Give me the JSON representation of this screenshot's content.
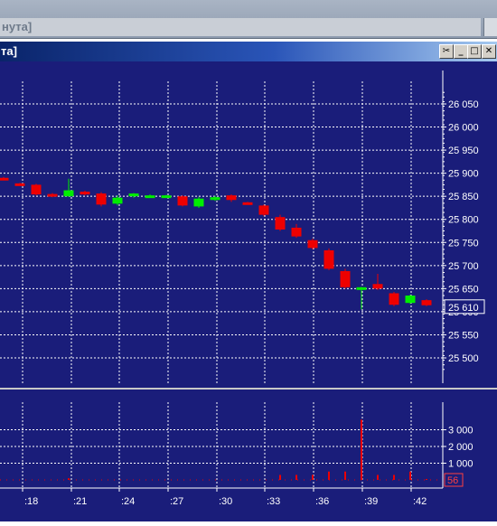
{
  "window": {
    "outer_title": "нута]",
    "inner_title": "та]",
    "buttons": [
      "pin",
      "minimize",
      "maximize",
      "close"
    ]
  },
  "colors": {
    "background": "#1a1d7a",
    "grid": "#ffffff",
    "up": "#00ee00",
    "down": "#ee0000",
    "text": "#ffffff",
    "current_price_text": "#ff4040"
  },
  "price_axis": {
    "labels": [
      "26 050",
      "26 000",
      "25 950",
      "25 900",
      "25 850",
      "25 800",
      "25 750",
      "25 700",
      "25 650",
      "25 600",
      "25 550",
      "25 500"
    ],
    "current_price": "25 610"
  },
  "volume_axis": {
    "labels": [
      "3 000",
      "2 000",
      "1 000"
    ],
    "current_volume": "56"
  },
  "time_axis": {
    "labels": [
      ":18",
      ":21",
      ":24",
      ":27",
      ":30",
      ":33",
      ":36",
      ":39",
      ":42"
    ]
  },
  "chart_data": {
    "type": "candlestick",
    "ylim": [
      25470,
      26090
    ],
    "volume_ylim": [
      0,
      3700
    ],
    "candles": [
      {
        "o": 25890,
        "c": 25888,
        "h": 25892,
        "l": 25886,
        "v": 0
      },
      {
        "o": 25878,
        "c": 25876,
        "h": 25879,
        "l": 25874,
        "v": 0
      },
      {
        "o": 25875,
        "c": 25854,
        "h": 25877,
        "l": 25852,
        "v": 0
      },
      {
        "o": 25855,
        "c": 25852,
        "h": 25857,
        "l": 25848,
        "v": 0
      },
      {
        "o": 25850,
        "c": 25863,
        "h": 25888,
        "l": 25849,
        "v": 100
      },
      {
        "o": 25860,
        "c": 25854,
        "h": 25862,
        "l": 25852,
        "v": 0
      },
      {
        "o": 25856,
        "c": 25832,
        "h": 25859,
        "l": 25828,
        "v": 0
      },
      {
        "o": 25834,
        "c": 25847,
        "h": 25852,
        "l": 25830,
        "v": 0
      },
      {
        "o": 25850,
        "c": 25856,
        "h": 25857,
        "l": 25847,
        "v": 0
      },
      {
        "o": 25852,
        "c": 25852,
        "h": 25854,
        "l": 25849,
        "v": 0
      },
      {
        "o": 25852,
        "c": 25852,
        "h": 25853,
        "l": 25850,
        "v": 0
      },
      {
        "o": 25850,
        "c": 25830,
        "h": 25852,
        "l": 25828,
        "v": 0
      },
      {
        "o": 25828,
        "c": 25845,
        "h": 25849,
        "l": 25825,
        "v": 0
      },
      {
        "o": 25842,
        "c": 25848,
        "h": 25851,
        "l": 25840,
        "v": 0
      },
      {
        "o": 25852,
        "c": 25842,
        "h": 25854,
        "l": 25838,
        "v": 0
      },
      {
        "o": 25837,
        "c": 25834,
        "h": 25838,
        "l": 25832,
        "v": 0
      },
      {
        "o": 25830,
        "c": 25810,
        "h": 25832,
        "l": 25807,
        "v": 0
      },
      {
        "o": 25805,
        "c": 25778,
        "h": 25810,
        "l": 25775,
        "v": 300
      },
      {
        "o": 25782,
        "c": 25763,
        "h": 25790,
        "l": 25760,
        "v": 300
      },
      {
        "o": 25755,
        "c": 25738,
        "h": 25758,
        "l": 25735,
        "v": 300
      },
      {
        "o": 25733,
        "c": 25693,
        "h": 25737,
        "l": 25690,
        "v": 500
      },
      {
        "o": 25688,
        "c": 25653,
        "h": 25693,
        "l": 25650,
        "v": 500
      },
      {
        "o": 25651,
        "c": 25653,
        "h": 25654,
        "l": 25605,
        "v": 3600
      },
      {
        "o": 25660,
        "c": 25650,
        "h": 25682,
        "l": 25647,
        "v": 300
      },
      {
        "o": 25640,
        "c": 25615,
        "h": 25643,
        "l": 25612,
        "v": 300
      },
      {
        "o": 25619,
        "c": 25635,
        "h": 25637,
        "l": 25617,
        "v": 500
      },
      {
        "o": 25625,
        "c": 25614,
        "h": 25627,
        "l": 25612,
        "v": 56
      }
    ]
  }
}
